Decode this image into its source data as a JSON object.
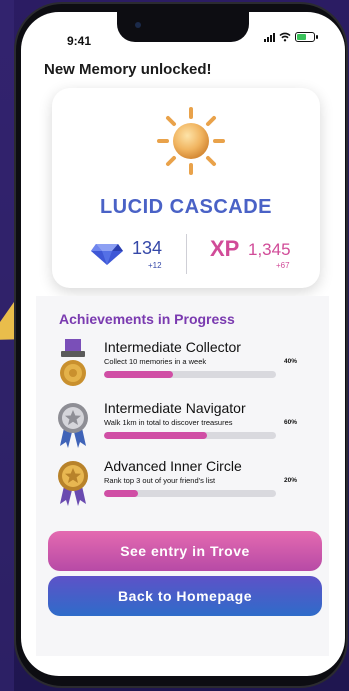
{
  "status_bar": {
    "time": "9:41"
  },
  "header": {
    "title": "New Memory unlocked!"
  },
  "memory": {
    "name": "LUCID CASCADE",
    "icon": "sun-icon",
    "gems": {
      "value": "134",
      "delta": "+12",
      "icon": "gem-icon"
    },
    "xp": {
      "label": "XP",
      "value": "1,345",
      "delta": "+67"
    }
  },
  "achievements": {
    "heading": "Achievements in Progress",
    "items": [
      {
        "title": "Intermediate Collector",
        "desc": "Collect 10 memories in a week",
        "progress_label": "40%",
        "progress": 0.4,
        "medal": "gold-medal-icon"
      },
      {
        "title": "Intermediate Navigator",
        "desc": "Walk 1km in total to discover treasures",
        "progress_label": "60%",
        "progress": 0.6,
        "medal": "silver-star-medal-icon"
      },
      {
        "title": "Advanced Inner Circle",
        "desc": "Rank top 3 out of your friend's list",
        "progress_label": "20%",
        "progress": 0.2,
        "medal": "gold-star-medal-icon"
      }
    ]
  },
  "actions": {
    "trove_label": "See entry in Trove",
    "home_label": "Back to Homepage"
  },
  "colors": {
    "accent_blue": "#4a62c6",
    "accent_pink": "#d14b98",
    "progress_fill": "#d04ea5",
    "heading_purple": "#7a3ab0"
  }
}
